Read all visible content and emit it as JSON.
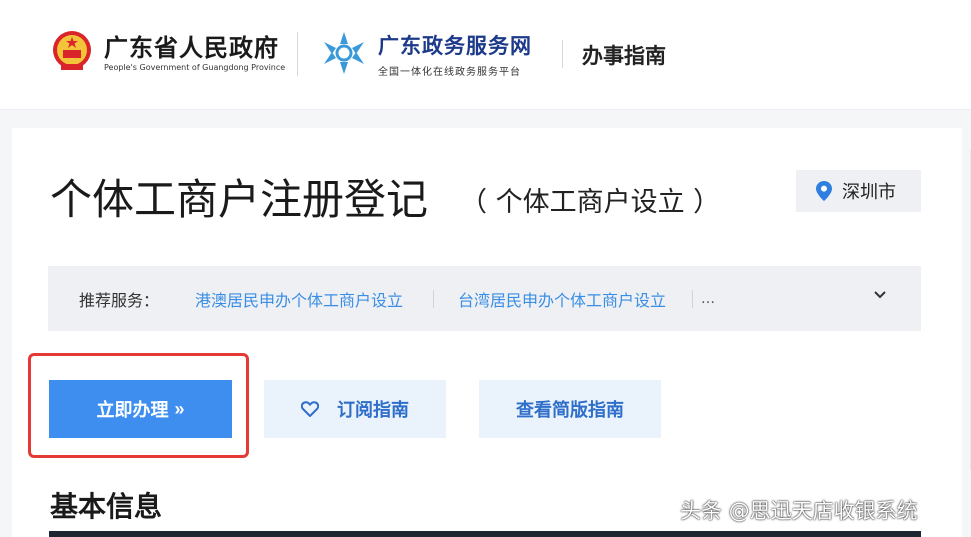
{
  "header": {
    "gov_title": "广东省人民政府",
    "gov_subtitle": "People's Government of Guangdong Province",
    "service_title": "广东政务服务网",
    "service_subtitle": "全国一体化在线政务服务平台",
    "section": "办事指南"
  },
  "page": {
    "title": "个体工商户注册登记",
    "subtitle": "（ 个体工商户设立 ）",
    "city": "深圳市"
  },
  "recommend": {
    "label": "推荐服务：",
    "links": [
      "港澳居民申办个体工商户设立",
      "台湾居民申办个体工商户设立"
    ],
    "more": "…"
  },
  "actions": {
    "apply": "立即办理",
    "apply_arrows": "»",
    "subscribe": "订阅指南",
    "simple": "查看简版指南"
  },
  "section": {
    "title": "基本信息"
  },
  "watermark": "头条 @思迅天店收银系统",
  "colors": {
    "primary": "#3e8ef0",
    "link": "#3a8ee6",
    "highlight_border": "#e53935",
    "service_brand": "#1d3a8a"
  },
  "icons": [
    "national-emblem-icon",
    "snowflake-logo-icon",
    "location-pin-icon",
    "chevron-down-icon",
    "heart-icon"
  ]
}
